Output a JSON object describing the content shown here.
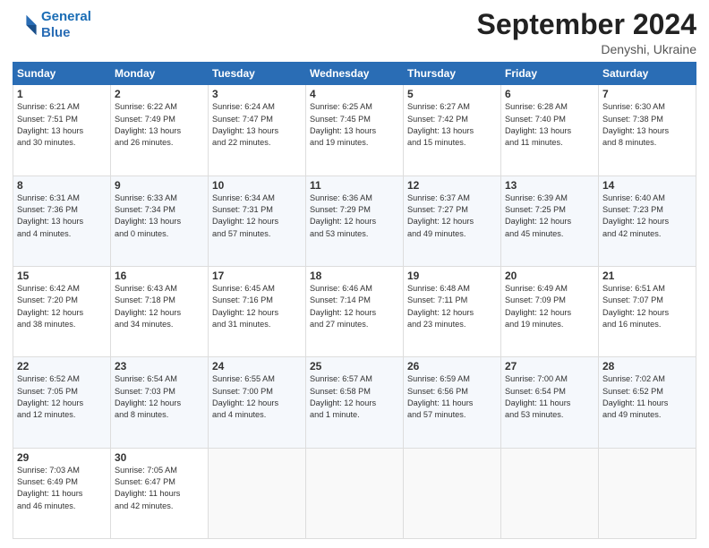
{
  "header": {
    "logo_line1": "General",
    "logo_line2": "Blue",
    "month": "September 2024",
    "location": "Denyshi, Ukraine"
  },
  "days_of_week": [
    "Sunday",
    "Monday",
    "Tuesday",
    "Wednesday",
    "Thursday",
    "Friday",
    "Saturday"
  ],
  "weeks": [
    [
      {
        "day": "1",
        "text": "Sunrise: 6:21 AM\nSunset: 7:51 PM\nDaylight: 13 hours\nand 30 minutes."
      },
      {
        "day": "2",
        "text": "Sunrise: 6:22 AM\nSunset: 7:49 PM\nDaylight: 13 hours\nand 26 minutes."
      },
      {
        "day": "3",
        "text": "Sunrise: 6:24 AM\nSunset: 7:47 PM\nDaylight: 13 hours\nand 22 minutes."
      },
      {
        "day": "4",
        "text": "Sunrise: 6:25 AM\nSunset: 7:45 PM\nDaylight: 13 hours\nand 19 minutes."
      },
      {
        "day": "5",
        "text": "Sunrise: 6:27 AM\nSunset: 7:42 PM\nDaylight: 13 hours\nand 15 minutes."
      },
      {
        "day": "6",
        "text": "Sunrise: 6:28 AM\nSunset: 7:40 PM\nDaylight: 13 hours\nand 11 minutes."
      },
      {
        "day": "7",
        "text": "Sunrise: 6:30 AM\nSunset: 7:38 PM\nDaylight: 13 hours\nand 8 minutes."
      }
    ],
    [
      {
        "day": "8",
        "text": "Sunrise: 6:31 AM\nSunset: 7:36 PM\nDaylight: 13 hours\nand 4 minutes."
      },
      {
        "day": "9",
        "text": "Sunrise: 6:33 AM\nSunset: 7:34 PM\nDaylight: 13 hours\nand 0 minutes."
      },
      {
        "day": "10",
        "text": "Sunrise: 6:34 AM\nSunset: 7:31 PM\nDaylight: 12 hours\nand 57 minutes."
      },
      {
        "day": "11",
        "text": "Sunrise: 6:36 AM\nSunset: 7:29 PM\nDaylight: 12 hours\nand 53 minutes."
      },
      {
        "day": "12",
        "text": "Sunrise: 6:37 AM\nSunset: 7:27 PM\nDaylight: 12 hours\nand 49 minutes."
      },
      {
        "day": "13",
        "text": "Sunrise: 6:39 AM\nSunset: 7:25 PM\nDaylight: 12 hours\nand 45 minutes."
      },
      {
        "day": "14",
        "text": "Sunrise: 6:40 AM\nSunset: 7:23 PM\nDaylight: 12 hours\nand 42 minutes."
      }
    ],
    [
      {
        "day": "15",
        "text": "Sunrise: 6:42 AM\nSunset: 7:20 PM\nDaylight: 12 hours\nand 38 minutes."
      },
      {
        "day": "16",
        "text": "Sunrise: 6:43 AM\nSunset: 7:18 PM\nDaylight: 12 hours\nand 34 minutes."
      },
      {
        "day": "17",
        "text": "Sunrise: 6:45 AM\nSunset: 7:16 PM\nDaylight: 12 hours\nand 31 minutes."
      },
      {
        "day": "18",
        "text": "Sunrise: 6:46 AM\nSunset: 7:14 PM\nDaylight: 12 hours\nand 27 minutes."
      },
      {
        "day": "19",
        "text": "Sunrise: 6:48 AM\nSunset: 7:11 PM\nDaylight: 12 hours\nand 23 minutes."
      },
      {
        "day": "20",
        "text": "Sunrise: 6:49 AM\nSunset: 7:09 PM\nDaylight: 12 hours\nand 19 minutes."
      },
      {
        "day": "21",
        "text": "Sunrise: 6:51 AM\nSunset: 7:07 PM\nDaylight: 12 hours\nand 16 minutes."
      }
    ],
    [
      {
        "day": "22",
        "text": "Sunrise: 6:52 AM\nSunset: 7:05 PM\nDaylight: 12 hours\nand 12 minutes."
      },
      {
        "day": "23",
        "text": "Sunrise: 6:54 AM\nSunset: 7:03 PM\nDaylight: 12 hours\nand 8 minutes."
      },
      {
        "day": "24",
        "text": "Sunrise: 6:55 AM\nSunset: 7:00 PM\nDaylight: 12 hours\nand 4 minutes."
      },
      {
        "day": "25",
        "text": "Sunrise: 6:57 AM\nSunset: 6:58 PM\nDaylight: 12 hours\nand 1 minute."
      },
      {
        "day": "26",
        "text": "Sunrise: 6:59 AM\nSunset: 6:56 PM\nDaylight: 11 hours\nand 57 minutes."
      },
      {
        "day": "27",
        "text": "Sunrise: 7:00 AM\nSunset: 6:54 PM\nDaylight: 11 hours\nand 53 minutes."
      },
      {
        "day": "28",
        "text": "Sunrise: 7:02 AM\nSunset: 6:52 PM\nDaylight: 11 hours\nand 49 minutes."
      }
    ],
    [
      {
        "day": "29",
        "text": "Sunrise: 7:03 AM\nSunset: 6:49 PM\nDaylight: 11 hours\nand 46 minutes."
      },
      {
        "day": "30",
        "text": "Sunrise: 7:05 AM\nSunset: 6:47 PM\nDaylight: 11 hours\nand 42 minutes."
      },
      {
        "day": "",
        "text": ""
      },
      {
        "day": "",
        "text": ""
      },
      {
        "day": "",
        "text": ""
      },
      {
        "day": "",
        "text": ""
      },
      {
        "day": "",
        "text": ""
      }
    ]
  ]
}
